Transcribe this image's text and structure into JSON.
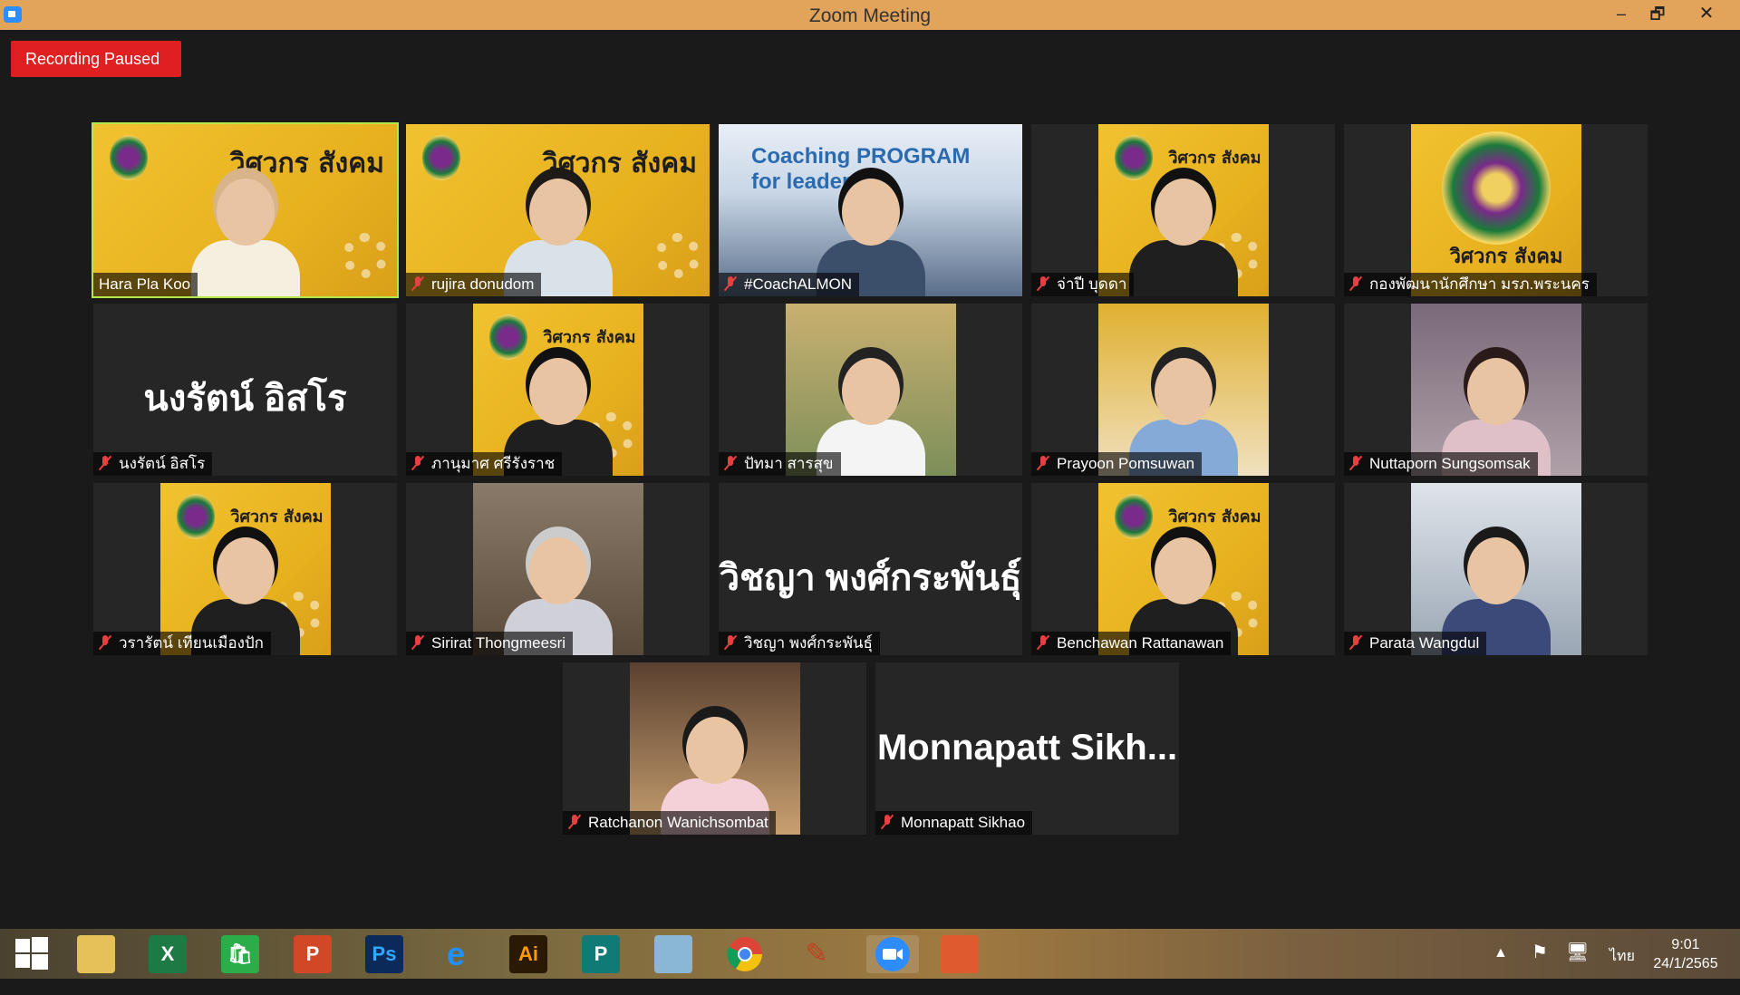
{
  "window": {
    "title": "Zoom Meeting",
    "minimize_glyph": "–",
    "maximize_glyph": "🗗",
    "close_glyph": "✕"
  },
  "recording": {
    "label": "Recording Paused"
  },
  "participants": [
    {
      "name": "Hara Pla Koo",
      "muted": false,
      "active_speaker": true,
      "display": "video",
      "poster_text": "วิศวกร สังคม"
    },
    {
      "name": "rujira donudom",
      "muted": true,
      "display": "video",
      "poster_text": "วิศวกร สังคม"
    },
    {
      "name": "#CoachALMON",
      "muted": true,
      "display": "video",
      "banner_text": "Coaching PROGRAM for leader"
    },
    {
      "name": "จ่าปี บุดดา",
      "muted": true,
      "display": "photo",
      "poster_text": "วิศวกร สังคม"
    },
    {
      "name": "กองพัฒนานักศึกษา มรภ.พระนคร",
      "muted": true,
      "display": "photo",
      "poster_text": "วิศวกร สังคม"
    },
    {
      "name": "นงรัตน์ อิสโร",
      "muted": true,
      "display": "name",
      "big_name": "นงรัตน์ อิสโร"
    },
    {
      "name": "ภานุมาศ ศรีรังราช",
      "muted": true,
      "display": "photo",
      "poster_text": "วิศวกร สังคม"
    },
    {
      "name": "ปัทมา สารสุข",
      "muted": true,
      "display": "photo"
    },
    {
      "name": "Prayoon Pomsuwan",
      "muted": true,
      "display": "photo"
    },
    {
      "name": "Nuttaporn Sungsomsak",
      "muted": true,
      "display": "photo"
    },
    {
      "name": "วรารัตน์ เทียนเมืองปัก",
      "muted": true,
      "display": "photo",
      "poster_text": "วิศวกร สังคม"
    },
    {
      "name": "Sirirat Thongmeesri",
      "muted": true,
      "display": "photo"
    },
    {
      "name": "วิชญา พงศ์กระพันธุ์",
      "muted": true,
      "display": "name",
      "big_name": "วิชญา พงศ์กระพันธุ์"
    },
    {
      "name": "Benchawan Rattanawan",
      "muted": true,
      "display": "photo",
      "poster_text": "วิศวกร สังคม"
    },
    {
      "name": "Parata Wangdul",
      "muted": true,
      "display": "photo"
    },
    {
      "name": "Ratchanon Wanichsombat",
      "muted": true,
      "display": "photo"
    },
    {
      "name": "Monnapatt Sikhao",
      "muted": true,
      "display": "name",
      "big_name": "Monnapatt  Sikh..."
    }
  ],
  "taskbar": {
    "apps": [
      "start-icon",
      "file-explorer-icon",
      "excel-icon",
      "store-icon",
      "powerpoint-icon",
      "photoshop-icon",
      "internet-explorer-icon",
      "illustrator-icon",
      "publisher-icon",
      "notepad-icon",
      "chrome-icon",
      "paint-icon",
      "zoom-icon",
      "ppt-viewer-icon"
    ],
    "labels": {
      "excel": "X",
      "powerpoint": "P",
      "photoshop": "Ps",
      "illustrator": "Ai",
      "publisher": "P"
    },
    "tray": {
      "language": "ไทย",
      "time": "9:01",
      "date": "24/1/2565"
    }
  },
  "colors": {
    "titlebar": "#e2a35a",
    "recording": "#e02020",
    "active_speaker_border": "#b7e64a",
    "muted_icon": "#e84040",
    "poster_yellow": "#f1c230"
  }
}
